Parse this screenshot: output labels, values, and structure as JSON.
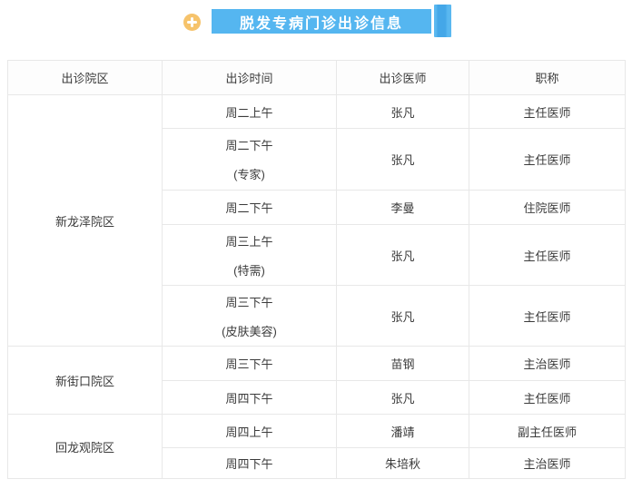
{
  "header": {
    "title": "脱发专病门诊出诊信息"
  },
  "colors": {
    "banner_blue": "#55b6f0",
    "ribbon_dark_blue": "#44a7e8",
    "plus_badge_orange": "#f6c36b",
    "row_stripe_blue": "#f4f8fd",
    "table_border": "#e8e8e8"
  },
  "table": {
    "columns": [
      "出诊院区",
      "出诊时间",
      "出诊医师",
      "职称"
    ],
    "rows": [
      {
        "campus": "新龙泽院区",
        "campus_rowspan": 5,
        "time": [
          "周二上午"
        ],
        "doctor": "张凡",
        "title": "主任医师"
      },
      {
        "time": [
          "周二下午",
          "(专家)"
        ],
        "doctor": "张凡",
        "title": "主任医师"
      },
      {
        "time": [
          "周二下午"
        ],
        "doctor": "李曼",
        "title": "住院医师"
      },
      {
        "time": [
          "周三上午",
          "(特需)"
        ],
        "doctor": "张凡",
        "title": "主任医师"
      },
      {
        "time": [
          "周三下午",
          "(皮肤美容)"
        ],
        "doctor": "张凡",
        "title": "主任医师"
      },
      {
        "campus": "新街口院区",
        "campus_rowspan": 2,
        "time": [
          "周三下午"
        ],
        "doctor": "苗钢",
        "title": "主治医师"
      },
      {
        "time": [
          "周四下午"
        ],
        "doctor": "张凡",
        "title": "主任医师"
      },
      {
        "campus": "回龙观院区",
        "campus_rowspan": 2,
        "time": [
          "周四上午"
        ],
        "doctor": "潘靖",
        "title": "副主任医师"
      },
      {
        "time": [
          "周四下午"
        ],
        "doctor": "朱培秋",
        "title": "主治医师"
      }
    ]
  }
}
